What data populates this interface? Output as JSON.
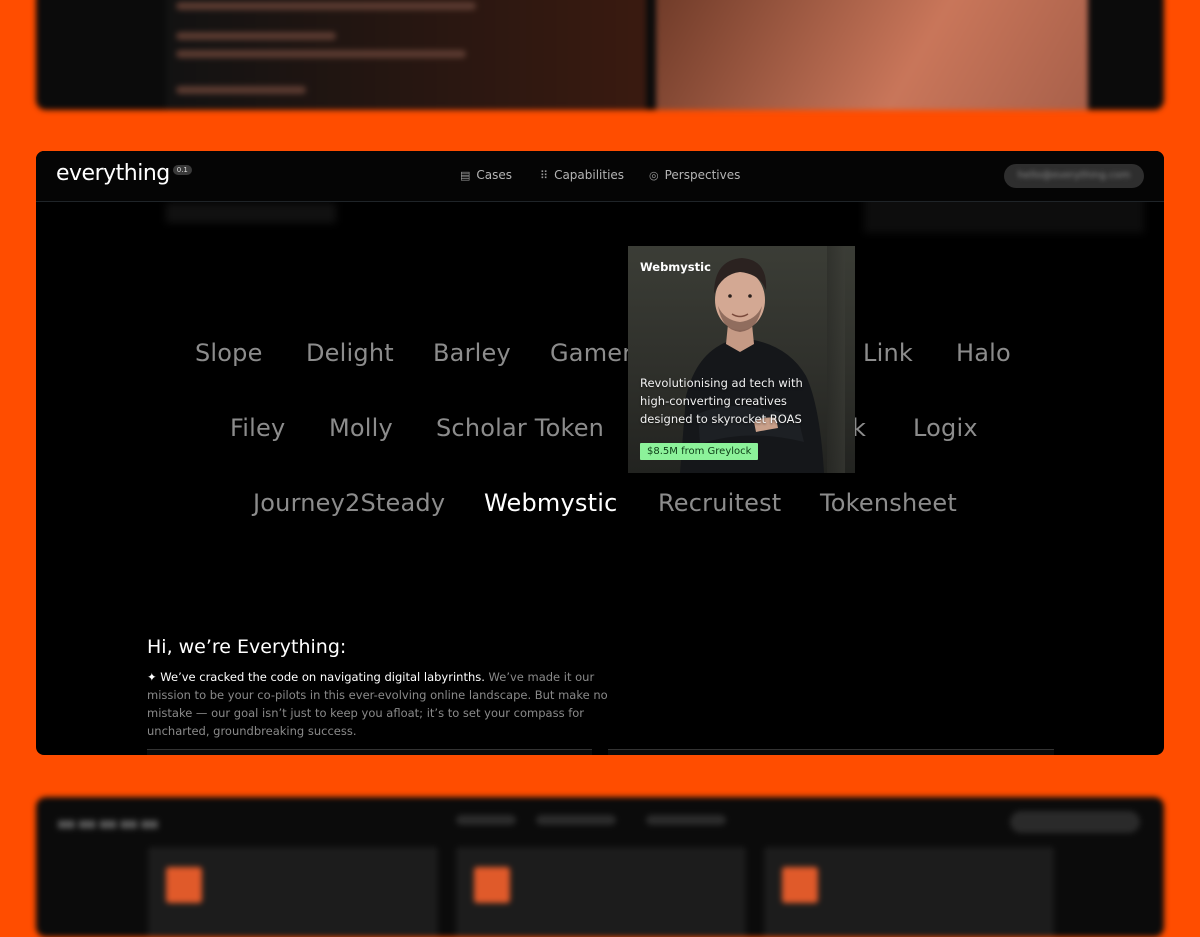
{
  "window": {
    "logo": "everything",
    "version": "0.1",
    "nav": [
      {
        "label": "Cases",
        "icon": "cases-icon"
      },
      {
        "label": "Capabilities",
        "icon": "grid-icon"
      },
      {
        "label": "Perspectives",
        "icon": "eye-icon"
      }
    ],
    "contact": "hello@everything.com"
  },
  "companies": {
    "row1": [
      "Slope",
      "Delight",
      "Barley",
      "Gamer",
      "Link",
      "Halo"
    ],
    "row2": [
      "Filey",
      "Molly",
      "Scholar Token",
      "k",
      "Logix"
    ],
    "row3": [
      "Journey2Steady",
      "Webmystic",
      "Recruitest",
      "Tokensheet"
    ],
    "active": "Webmystic"
  },
  "hover_card": {
    "name": "Webmystic",
    "description": "Revolutionising ad tech with high-converting creatives designed to skyrocket ROAS",
    "badge": "$8.5M from Greylock",
    "badge_color": "#8cf29a"
  },
  "intro": {
    "title": "Hi, we’re Everything:",
    "lead": "✦ We’ve cracked the code on navigating digital labyrinths.",
    "body": " We’ve made it our mission to be your co-pilots in this ever-evolving online landscape. But make no mistake — our goal isn’t just to keep you afloat; it’s to set your compass for uncharted, groundbreaking success."
  },
  "colors": {
    "background": "#ff4d00",
    "window": "#000000",
    "accent_badge": "#8cf29a"
  }
}
